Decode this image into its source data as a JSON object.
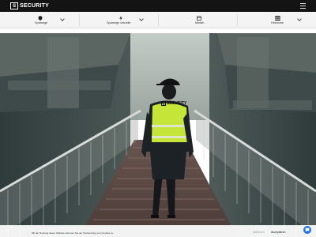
{
  "brand": {
    "logo_mark": "S",
    "name": "SECURITY"
  },
  "header": {
    "menu_icon": "hamburger-icon"
  },
  "nav": {
    "items": [
      {
        "label": "Sparsege",
        "icon": "shield-icon"
      },
      {
        "label": "Sparsege virtuelle",
        "icon": "lightning-icon"
      },
      {
        "label": "Mietah",
        "icon": "calendar-icon"
      },
      {
        "label": "Hirensine",
        "icon": "list-icon"
      }
    ]
  },
  "hero": {
    "vest_text": "SECURITY",
    "vest_logo_mark": "S"
  },
  "cookie": {
    "text": "Mit der Nutzung dieser Website stimmen Sie der Verwendung von Cookies zu.",
    "reject": "Ablehnen",
    "accept": "Akzeptieren"
  },
  "colors": {
    "topbar": "#141414",
    "nav_bg": "#f4f4f4",
    "accent": "#1e73e8",
    "vest": "#c5e639"
  }
}
